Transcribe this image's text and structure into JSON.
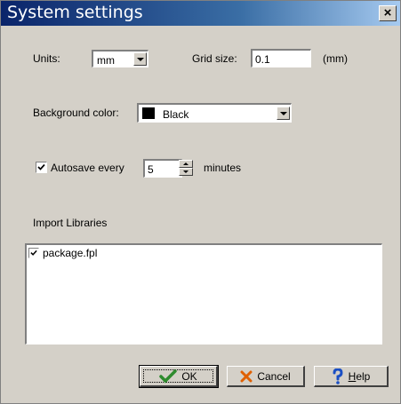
{
  "window": {
    "title": "System settings",
    "close_label": "×"
  },
  "units": {
    "label": "Units:",
    "value": "mm"
  },
  "grid": {
    "label": "Grid size:",
    "value": "0.1",
    "unit": "(mm)"
  },
  "background": {
    "label": "Background color:",
    "value": "Black",
    "swatch": "#000000"
  },
  "autosave": {
    "label": "Autosave every",
    "checked": true,
    "value": "5",
    "suffix": "minutes"
  },
  "import": {
    "label": "Import Libraries",
    "items": [
      {
        "label": "package.fpl",
        "checked": true
      }
    ]
  },
  "buttons": {
    "ok": "OK",
    "cancel": "Cancel",
    "help_first": "H",
    "help_rest": "elp"
  },
  "icons": {
    "ok": "check-icon",
    "cancel": "x-icon",
    "help": "question-mark-icon"
  },
  "colors": {
    "ok_icon": "#2e8b2e",
    "cancel_icon": "#e06000",
    "help_icon": "#1a4fc4"
  }
}
